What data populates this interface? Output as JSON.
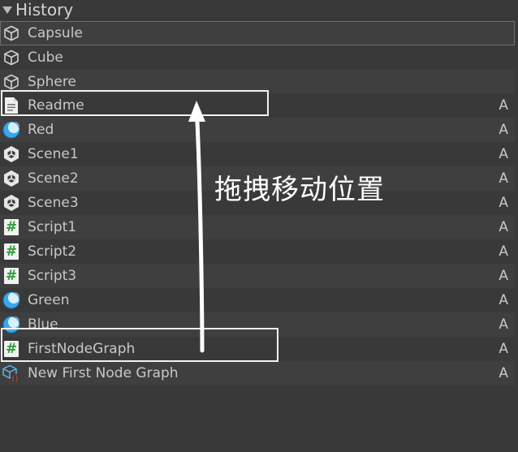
{
  "header": {
    "title": "History"
  },
  "items": [
    {
      "label": "Capsule",
      "icon": "prefab-cube-icon",
      "badge": ""
    },
    {
      "label": "Cube",
      "icon": "prefab-cube-icon",
      "badge": ""
    },
    {
      "label": "Sphere",
      "icon": "prefab-cube-icon",
      "badge": ""
    },
    {
      "label": "Readme",
      "icon": "text-document-icon",
      "badge": "A"
    },
    {
      "label": "Red",
      "icon": "material-sphere-icon",
      "badge": "A"
    },
    {
      "label": "Scene1",
      "icon": "unity-scene-icon",
      "badge": "A"
    },
    {
      "label": "Scene2",
      "icon": "unity-scene-icon",
      "badge": "A"
    },
    {
      "label": "Scene3",
      "icon": "unity-scene-icon",
      "badge": "A"
    },
    {
      "label": "Script1",
      "icon": "csharp-script-icon",
      "badge": "A"
    },
    {
      "label": "Script2",
      "icon": "csharp-script-icon",
      "badge": "A"
    },
    {
      "label": "Script3",
      "icon": "csharp-script-icon",
      "badge": "A"
    },
    {
      "label": "Green",
      "icon": "material-sphere-icon",
      "badge": "A"
    },
    {
      "label": "Blue",
      "icon": "material-sphere-icon",
      "badge": "A"
    },
    {
      "label": "FirstNodeGraph",
      "icon": "csharp-script-icon",
      "badge": "A"
    },
    {
      "label": "New First Node Graph",
      "icon": "node-graph-asset-icon",
      "badge": "A"
    }
  ],
  "annotation": {
    "text": "拖拽移动位置"
  },
  "colors": {
    "background": "#393939",
    "row_alt": "#3f3f3f",
    "text": "#c8c8c8",
    "sphere": "#3aa7ec",
    "script_green": "#2f9d3a",
    "annotation": "#ffffff"
  }
}
